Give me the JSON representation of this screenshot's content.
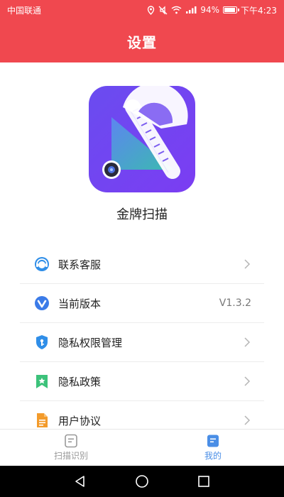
{
  "status_bar": {
    "carrier": "中国联通",
    "battery": "94%",
    "battery_level": 0.94,
    "time": "下午4:23"
  },
  "header": {
    "title": "设置"
  },
  "app": {
    "name": "金牌扫描"
  },
  "menu": [
    {
      "label": "联系客服",
      "value": "",
      "icon": "customer-service-icon",
      "color": "#2f8ee8"
    },
    {
      "label": "当前版本",
      "value": "V1.3.2",
      "icon": "version-icon",
      "color": "#3b7be8"
    },
    {
      "label": "隐私权限管理",
      "value": "",
      "icon": "privacy-shield-icon",
      "color": "#2f8ee8"
    },
    {
      "label": "隐私政策",
      "value": "",
      "icon": "policy-bookmark-icon",
      "color": "#3cc27a"
    },
    {
      "label": "用户协议",
      "value": "",
      "icon": "agreement-doc-icon",
      "color": "#f39b2b"
    }
  ],
  "tabs": [
    {
      "label": "扫描识别",
      "active": false
    },
    {
      "label": "我的",
      "active": true
    }
  ],
  "colors": {
    "header": "#f0484f",
    "accent": "#4a8ee6"
  }
}
